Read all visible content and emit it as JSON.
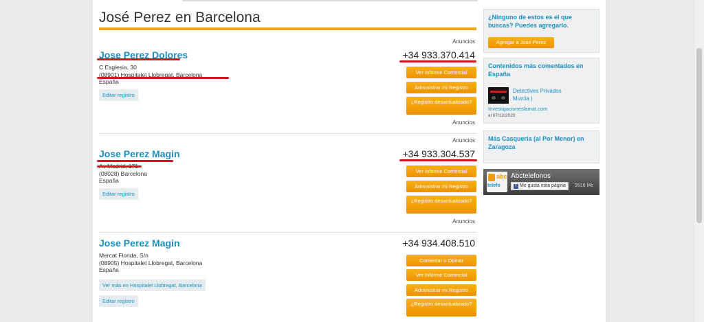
{
  "page_title": "José Perez en Barcelona",
  "ads_label": "Anuncios",
  "listings": [
    {
      "name": "Jose Perez Dolores",
      "address": [
        "C Esglesia, 30",
        "(08901) Hospitalet Llobregat, Barcelona",
        "España"
      ],
      "phone": "+34 933.370.414",
      "buttons": [
        "Ver Informe Comercial",
        "Administrar mi Registro",
        "¿Registro desactualizado?"
      ],
      "edit": "Editar registro"
    },
    {
      "name": "Jose Perez Magin",
      "address": [
        "Av Madrid, 171",
        "(08028) Barcelona",
        "España"
      ],
      "phone": "+34 933.304.537",
      "buttons": [
        "Ver Informe Comercial",
        "Administrar mi Registro",
        "¿Registro desactualizado?"
      ],
      "edit": "Editar registro"
    },
    {
      "name": "Jose Perez Magin",
      "address": [
        "Mercat Florida, S/n",
        "(08905) Hospitalet Llobregat, Barcelona",
        "España"
      ],
      "phone": "+34 934.408.510",
      "buttons": [
        "Comentar u Opinar",
        "Ver Informe Comercial",
        "Administrar mi Registro",
        "¿Registro desactualizado?"
      ],
      "more": "Ver más en Hospitalet Llobregat, Barcelona",
      "edit": "Editar registro"
    }
  ],
  "sidebar": {
    "add_box": {
      "title": "¿Ninguno de estos es el que buscas? Puedes agregarlo.",
      "button": "Agregar a Jose Perez"
    },
    "comments_box": {
      "title": "Contenidos más comentados en España",
      "item_title": "Detectives Privados Murcia |",
      "item_site": "Investigacioneslamat.com",
      "item_date": "el 07/12/2020"
    },
    "category_box": {
      "title": "Más Casquería (al Por Menor) en Zaragoza"
    },
    "facebook": {
      "page_name": "Abctelefonos",
      "like": "Me gusta esta página",
      "count": "9516 Me",
      "logo_ab": "abc",
      "logo_tel": "telefo"
    }
  },
  "colors": {
    "accent": "#f0a526",
    "link": "#1a8fc4",
    "button": "#f39c12",
    "annotation": "#d6141e"
  }
}
